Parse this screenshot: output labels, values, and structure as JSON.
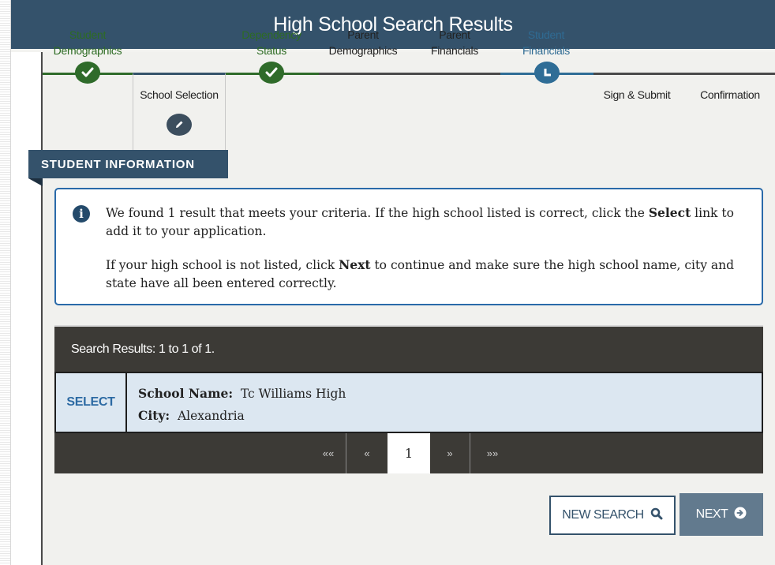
{
  "header": {
    "title": "High School Search Results"
  },
  "steps": [
    {
      "label_line1": "Student",
      "label_line2": "Demographics",
      "status": "complete",
      "icon": "check-icon"
    },
    {
      "label_line1": "School Selection",
      "label_line2": "",
      "status": "current",
      "icon": "pencil-icon"
    },
    {
      "label_line1": "Dependency",
      "label_line2": "Status",
      "status": "complete",
      "icon": "check-icon"
    },
    {
      "label_line1": "Parent",
      "label_line2": "Demographics",
      "status": "pending",
      "icon": ""
    },
    {
      "label_line1": "Parent",
      "label_line2": "Financials",
      "status": "pending",
      "icon": ""
    },
    {
      "label_line1": "Student",
      "label_line2": "Financials",
      "status": "in-progress",
      "icon": "clock-icon"
    },
    {
      "label_line1": "Sign & Submit",
      "label_line2": "",
      "status": "pending",
      "icon": ""
    },
    {
      "label_line1": "Confirmation",
      "label_line2": "",
      "status": "pending",
      "icon": ""
    }
  ],
  "section": {
    "title": "STUDENT INFORMATION"
  },
  "info": {
    "icon": "info-icon",
    "p1_part1": "We found 1 result that meets your criteria. If the high school listed is correct, click the ",
    "p1_bold": "Select",
    "p1_part2": " link to add it to your application.",
    "p2_part1": "If your high school is not listed, click ",
    "p2_bold": "Next",
    "p2_part2": " to continue and make sure the high school name, city and state have all been entered correctly."
  },
  "results": {
    "header": "Search Results: 1 to 1 of 1.",
    "rows": [
      {
        "select_label": "SELECT",
        "school_label": "School Name:",
        "school_value": "Tc Williams High",
        "city_label": "City:",
        "city_value": "Alexandria"
      }
    ]
  },
  "pagination": {
    "first": "««",
    "prev": "«",
    "current": "1",
    "next": "»",
    "last": "»»"
  },
  "buttons": {
    "new_search": "NEW SEARCH",
    "next": "NEXT"
  },
  "colors": {
    "header_bg": "#34526b",
    "complete": "#2f6b2a",
    "link": "#2c6aa3",
    "dark_bar": "#3c3a36",
    "row_bg": "#dce7f1"
  }
}
